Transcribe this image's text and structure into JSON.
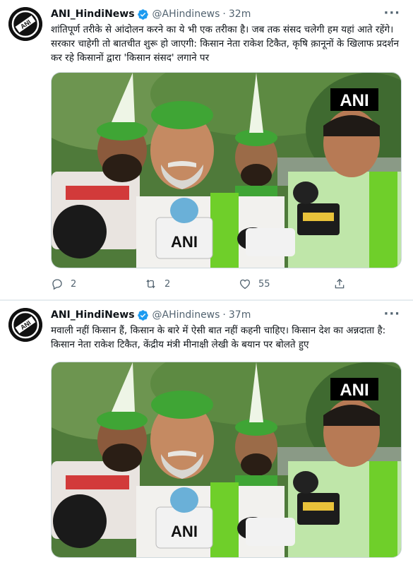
{
  "tweets": [
    {
      "author_name": "ANI_HindiNews",
      "handle": "@AHindinews",
      "separator": "·",
      "time": "32m",
      "more_label": "···",
      "text": "शांतिपूर्ण तरीके से आंदोलन करने का ये भी एक तरीका है। जब तक संसद चलेगी हम यहां आते रहेंगे। सरकार चाहेगी तो बातचीत शुरू हो जाएगी: किसान नेता राकेश टिकैत, कृषि क़ानूनों के खिलाफ प्रदर्शन कर रहे किसानों द्वारा 'किसान संसद' लगाने पर",
      "media_watermark": "ANI",
      "mic_label": "ANI",
      "actions": {
        "reply_count": "2",
        "retweet_count": "2",
        "like_count": "55"
      }
    },
    {
      "author_name": "ANI_HindiNews",
      "handle": "@AHindinews",
      "separator": "·",
      "time": "37m",
      "more_label": "···",
      "text": "मवाली नहीं किसान हैं, किसान के बारे में ऐसी बात नहीं कहनी चाहिए। किसान देश का अन्नदाता है: किसान नेता राकेश टिकैत, केंद्रीय मंत्री मीनाक्षी लेखी के बयान पर बोलते हुए",
      "media_watermark": "ANI",
      "mic_label": "ANI"
    }
  ],
  "colors": {
    "verified_blue": "#1d9bf0",
    "secondary_text": "#536471",
    "cap_green": "#3fa535",
    "scarf_green": "#6fcf2a"
  },
  "icons": [
    "avatar-ani-logo",
    "verified-badge-icon",
    "more-icon",
    "reply-icon",
    "retweet-icon",
    "like-icon",
    "share-icon"
  ]
}
